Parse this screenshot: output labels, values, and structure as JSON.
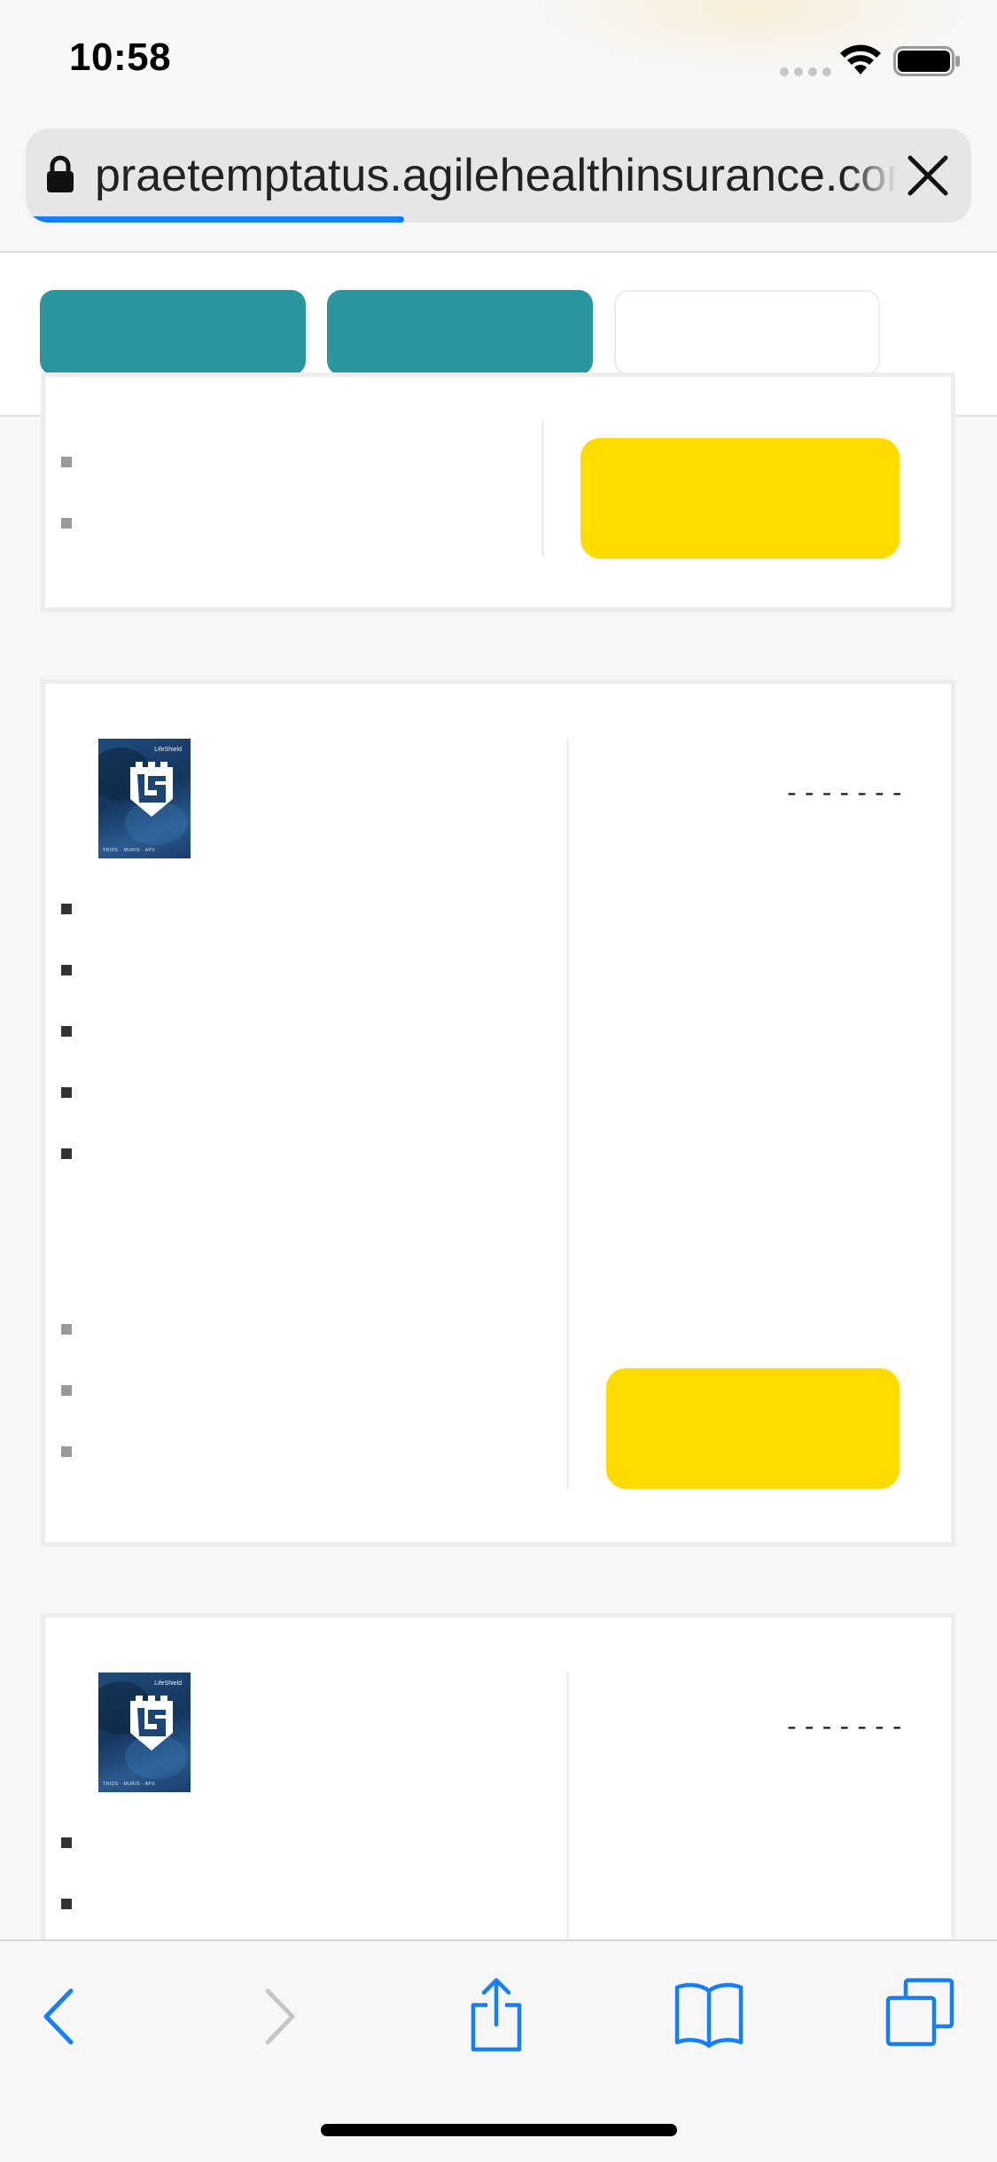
{
  "status_bar": {
    "time": "10:58"
  },
  "browser": {
    "url": "praetemptatus.agilehealthinsurance.com",
    "load_progress": 0.4,
    "accent_color": "#157efb"
  },
  "tabs": [
    {
      "name": "tab-1",
      "style": "teal"
    },
    {
      "name": "tab-2",
      "style": "teal"
    },
    {
      "name": "tab-3",
      "style": "white"
    }
  ],
  "plans": [
    {
      "logo_name": "LifeShield",
      "price_placeholder": "",
      "cta_label": ""
    },
    {
      "logo_name": "LifeShield",
      "price_placeholder": "-------",
      "cta_label": ""
    },
    {
      "logo_name": "LifeShield",
      "price_placeholder": "-------",
      "cta_label": ""
    }
  ],
  "colors": {
    "teal": "#2996a0",
    "cta_yellow": "#ffdb00"
  },
  "toolbar": {
    "icons": [
      "back-icon",
      "forward-icon",
      "share-icon",
      "bookmarks-icon",
      "tabs-icon"
    ]
  }
}
